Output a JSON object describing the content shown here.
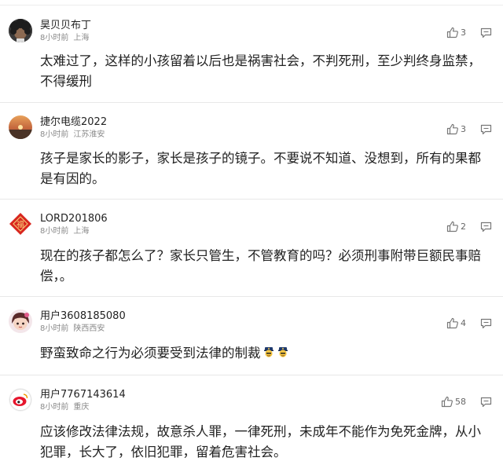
{
  "comments": [
    {
      "username": "昊贝贝布丁",
      "time": "8小时前",
      "location": "上海",
      "likes": "3",
      "text": "太难过了，这样的小孩留着以后也是祸害社会，不判死刑，至少判终身监禁，不得缓刑",
      "avatar_icon": "dark-curly-hair-avatar"
    },
    {
      "username": "捷尔电缆2022",
      "time": "8小时前",
      "location": "江苏淮安",
      "likes": "3",
      "text": "孩子是家长的影子，家长是孩子的镜子。不要说不知道、没想到，所有的果都是有因的。",
      "avatar_icon": "sunset-avatar"
    },
    {
      "username": "LORD201806",
      "time": "8小时前",
      "location": "上海",
      "likes": "2",
      "text": "现在的孩子都怎么了？家长只管生，不管教育的吗？必须刑事附带巨额民事赔偿，。",
      "avatar_icon": "red-diamond-avatar"
    },
    {
      "username": "用户3608185080",
      "time": "8小时前",
      "location": "陕西西安",
      "likes": "4",
      "text": "野蛮致命之行为必须要受到法律的制裁",
      "avatar_icon": "cartoon-girl-avatar",
      "emojis": [
        "police-emoji",
        "police-emoji"
      ]
    },
    {
      "username": "用户7767143614",
      "time": "8小时前",
      "location": "重庆",
      "likes": "58",
      "text": "应该修改法律法规，故意杀人罪，一律死刑，未成年不能作为免死金牌，从小犯罪，长大了，依旧犯罪，留着危害社会。",
      "avatar_icon": "weibo-logo-avatar"
    }
  ],
  "icons": {
    "like": "thumbs-up-icon",
    "reply": "comment-bubble-icon"
  }
}
